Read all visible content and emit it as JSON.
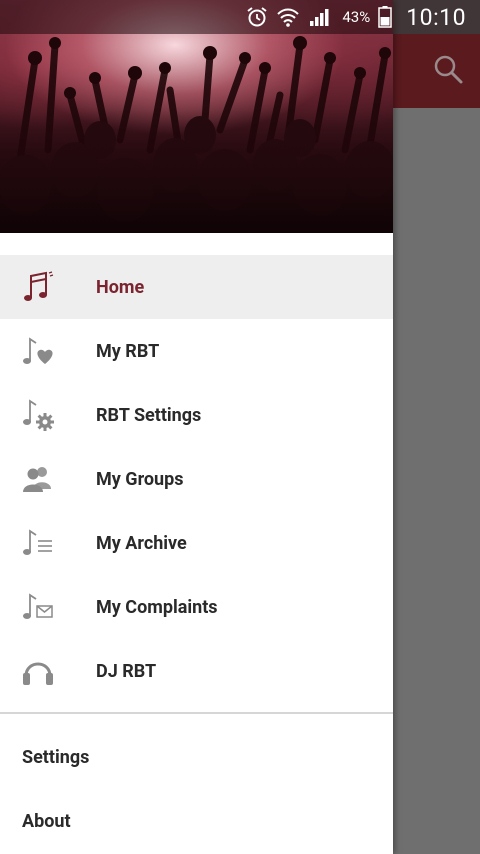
{
  "status_bar": {
    "battery_percent": "43%",
    "time": "10:10",
    "icons": [
      "alarm-icon",
      "wifi-icon",
      "signal-icon",
      "battery-icon"
    ]
  },
  "toolbar": {
    "search_icon": "search-icon",
    "color": "#5a1a1e"
  },
  "drawer": {
    "header_image": "concert-crowd-photo",
    "menu": [
      {
        "label": "Home",
        "icon": "music-notes-icon",
        "active": true
      },
      {
        "label": "My RBT",
        "icon": "music-heart-icon",
        "active": false
      },
      {
        "label": "RBT Settings",
        "icon": "music-gear-icon",
        "active": false
      },
      {
        "label": "My Groups",
        "icon": "group-icon",
        "active": false
      },
      {
        "label": "My Archive",
        "icon": "music-list-icon",
        "active": false
      },
      {
        "label": "My Complaints",
        "icon": "music-mail-icon",
        "active": false
      },
      {
        "label": "DJ RBT",
        "icon": "headphones-icon",
        "active": false
      }
    ],
    "footer": {
      "settings_label": "Settings",
      "about_label": "About"
    },
    "accent_color": "#7b2430",
    "icon_color": "#8a8a8a"
  }
}
